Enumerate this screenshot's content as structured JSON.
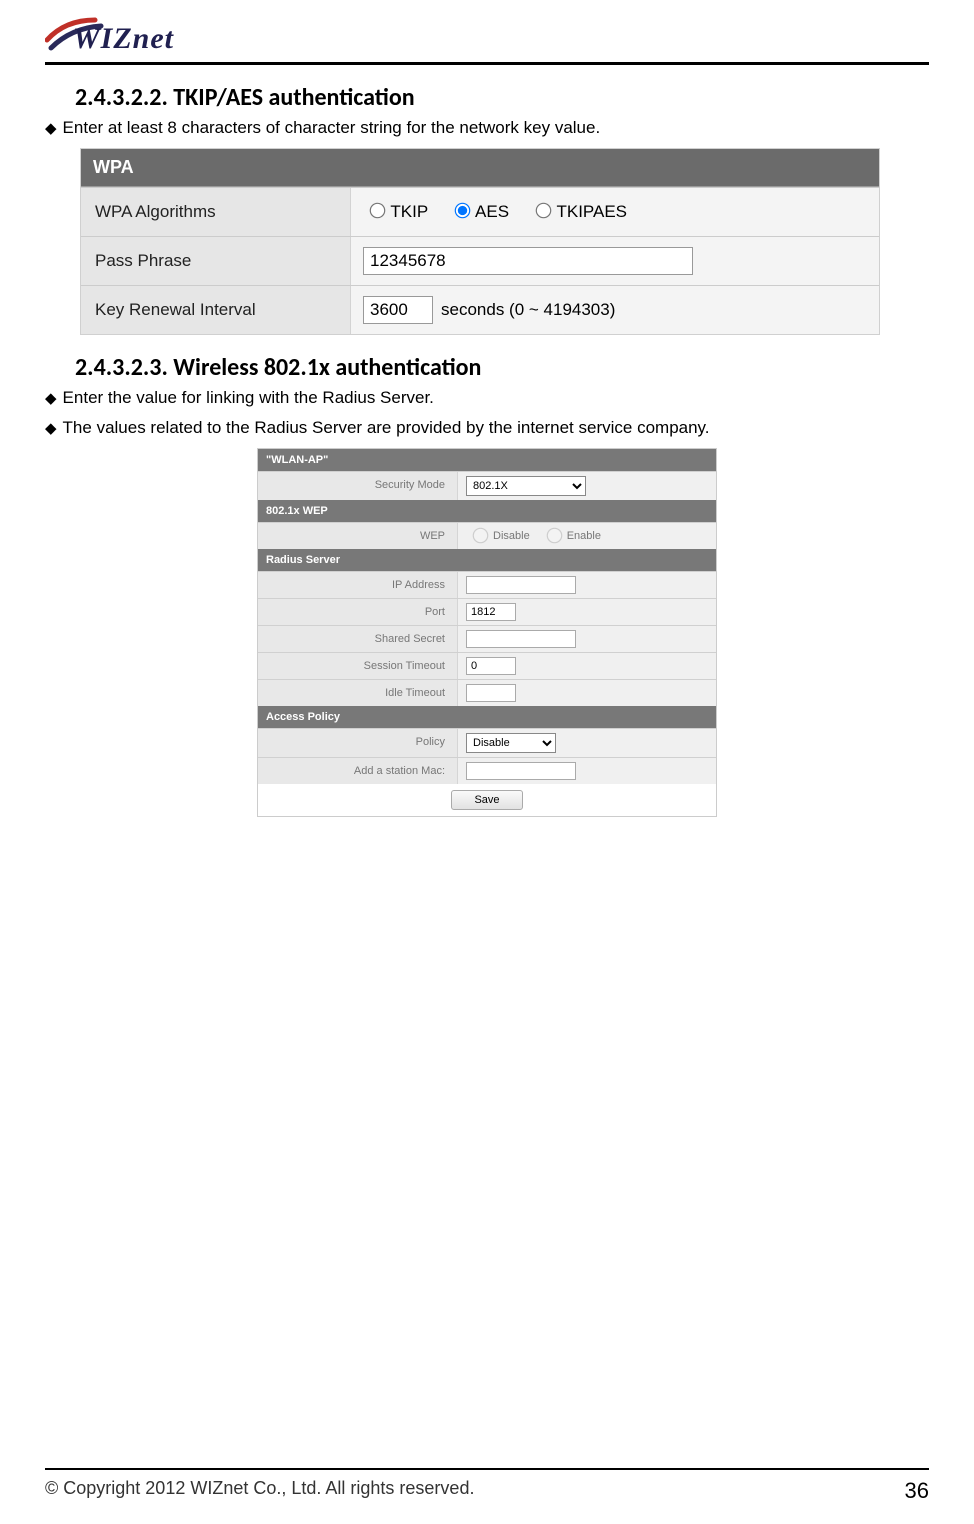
{
  "brand": "WIZnet",
  "heading1": "2.4.3.2.2. TKIP/AES  authentication",
  "bullet1": "Enter at least 8 characters of character string for the network key value.",
  "wpa": {
    "header": "WPA",
    "alg_label": "WPA Algorithms",
    "opt_tkip": "TKIP",
    "opt_aes": "AES",
    "opt_tkipaes": "TKIPAES",
    "pass_label": "Pass Phrase",
    "pass_value": "12345678",
    "renew_label": "Key Renewal Interval",
    "renew_value": "3600",
    "renew_suffix": "seconds   (0 ~ 4194303)"
  },
  "heading2": "2.4.3.2.3. Wireless  802.1x  authentication",
  "bullet2": "Enter the value for linking with the Radius Server.",
  "bullet3": "The values related to the Radius Server are provided by the internet service company.",
  "wlan": {
    "header": "\"WLAN-AP\"",
    "sec_label": "Security Mode",
    "sec_value": "802.1X",
    "wep_header": "802.1x WEP",
    "wep_label": "WEP",
    "wep_disable": "Disable",
    "wep_enable": "Enable",
    "radius_header": "Radius Server",
    "ip_label": "IP Address",
    "ip_value": "",
    "port_label": "Port",
    "port_value": "1812",
    "secret_label": "Shared Secret",
    "secret_value": "",
    "sess_label": "Session Timeout",
    "sess_value": "0",
    "idle_label": "Idle Timeout",
    "idle_value": "",
    "access_header": "Access Policy",
    "policy_label": "Policy",
    "policy_value": "Disable",
    "mac_label": "Add a station Mac:",
    "mac_value": "",
    "save": "Save"
  },
  "footer": {
    "copyright": "© Copyright 2012 WIZnet Co., Ltd. All rights reserved.",
    "page": "36"
  }
}
